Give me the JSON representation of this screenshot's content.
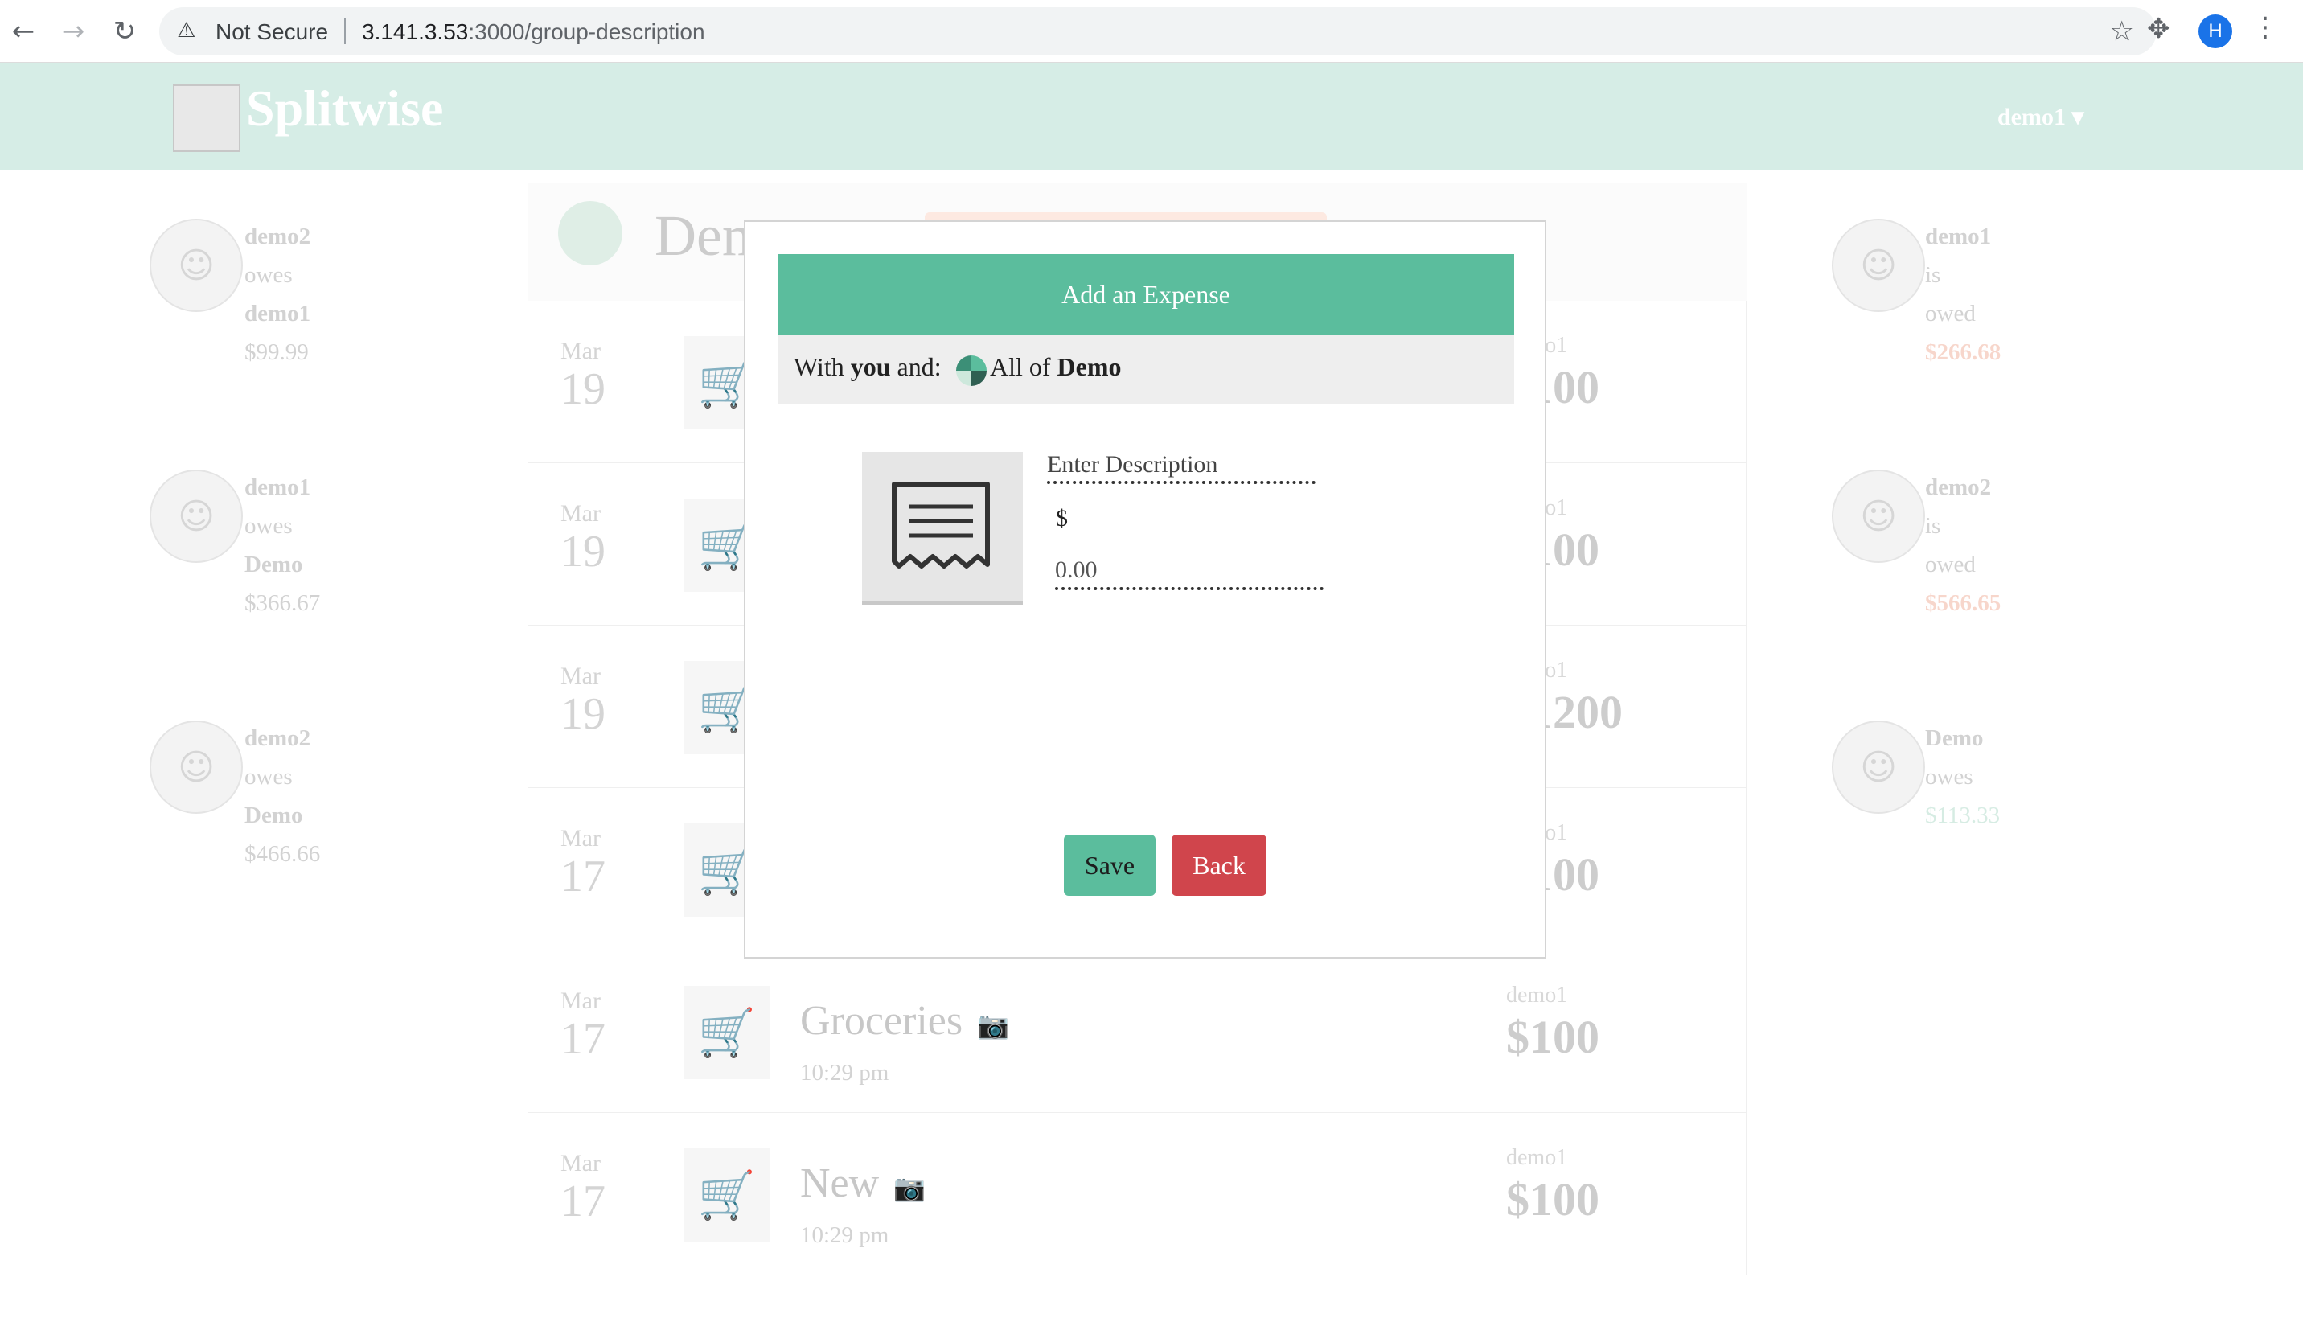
{
  "browser": {
    "security_label": "Not Secure",
    "url_host": "3.141.3.53",
    "url_path": ":3000/group-description",
    "profile_initial": "H"
  },
  "header": {
    "brand": "Splitwise",
    "user_menu": "demo1"
  },
  "left_balances": [
    {
      "a": "demo2",
      "verb": "owes",
      "b": "demo1",
      "amount": "$99.99"
    },
    {
      "a": "demo1",
      "verb": "owes",
      "b": "Demo",
      "amount": "$366.67"
    },
    {
      "a": "demo2",
      "verb": "owes",
      "b": "Demo",
      "amount": "$466.66"
    }
  ],
  "right_balances": [
    {
      "name": "demo1",
      "l1": "is",
      "l2": "owed",
      "amount": "$266.68"
    },
    {
      "name": "demo2",
      "l1": "is",
      "l2": "owed",
      "amount": "$566.65"
    },
    {
      "name": "Demo",
      "l1": "owes",
      "amount": "$113.33"
    }
  ],
  "group": {
    "name": "Demo"
  },
  "expenses": [
    {
      "month": "Mar",
      "day": "19",
      "title": "",
      "time": "",
      "payer": "demo1",
      "amount": "$100"
    },
    {
      "month": "Mar",
      "day": "19",
      "title": "",
      "time": "",
      "payer": "demo1",
      "amount": "$100"
    },
    {
      "month": "Mar",
      "day": "19",
      "title": "",
      "time": "",
      "payer": "demo1",
      "amount": "$1200"
    },
    {
      "month": "Mar",
      "day": "17",
      "title": "",
      "time": "",
      "payer": "demo1",
      "amount": "$100"
    },
    {
      "month": "Mar",
      "day": "17",
      "title": "Groceries",
      "time": "10:29 pm",
      "payer": "demo1",
      "amount": "$100"
    },
    {
      "month": "Mar",
      "day": "17",
      "title": "New",
      "time": "10:29 pm",
      "payer": "demo1",
      "amount": "$100"
    }
  ],
  "modal": {
    "title": "Add an Expense",
    "with_prefix": "With",
    "with_you": "you",
    "with_suffix": "and:",
    "all_of": "All of",
    "group_name": "Demo",
    "description_placeholder": "Enter Description",
    "currency": "$",
    "amount_placeholder": "0.00",
    "save_label": "Save",
    "back_label": "Back"
  },
  "colors": {
    "brand_green": "#5bbd9d",
    "header_bg": "#d6ede6",
    "danger": "#d0454c"
  }
}
